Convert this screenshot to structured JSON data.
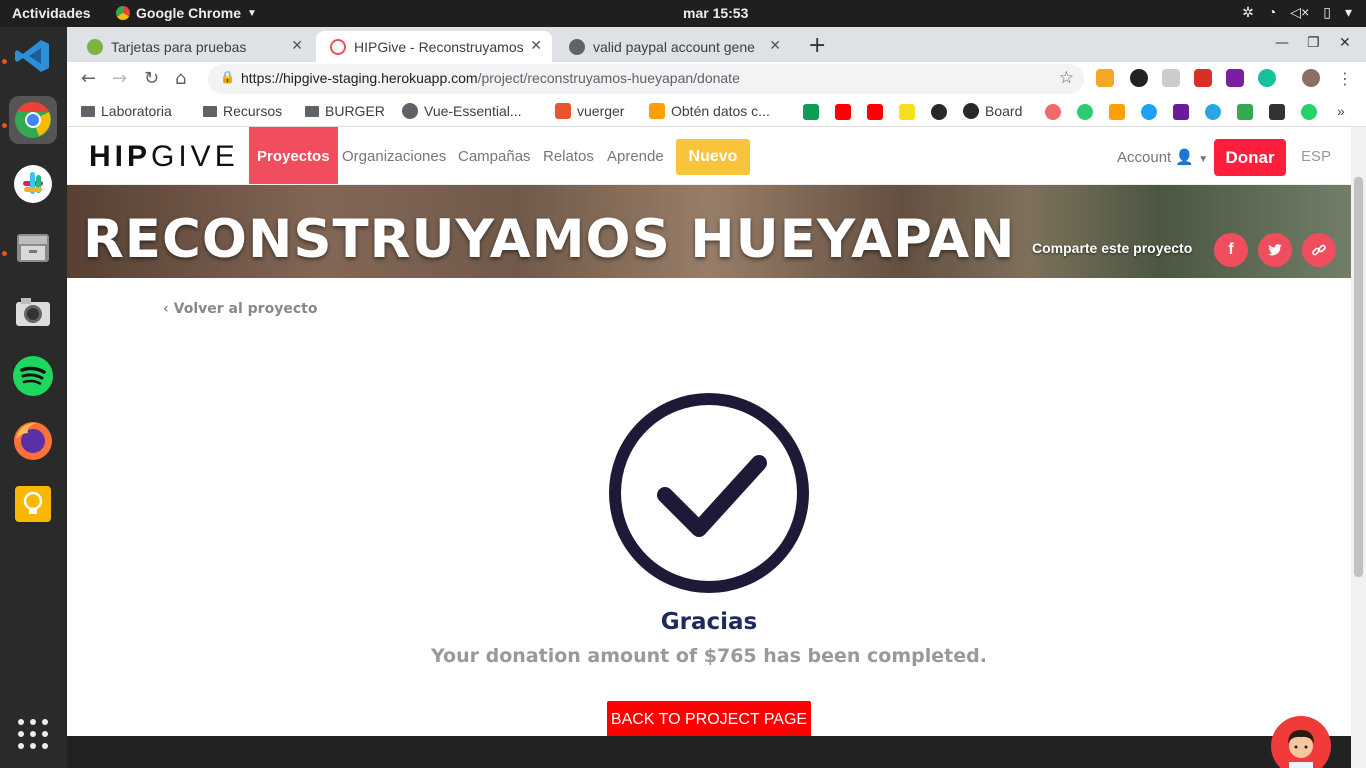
{
  "topbar": {
    "activities": "Actividades",
    "app_name": "Google Chrome",
    "clock": "mar 15:53"
  },
  "tabs": [
    {
      "title": "Tarjetas para pruebas"
    },
    {
      "title": "HIPGive - Reconstruyamos"
    },
    {
      "title": "valid paypal account gene"
    }
  ],
  "url": {
    "host": "https://hipgive-staging.herokuapp.com",
    "path": "/project/reconstruyamos-hueyapan/donate"
  },
  "bookmarks": [
    {
      "label": "Laboratoria"
    },
    {
      "label": "Recursos"
    },
    {
      "label": "BURGER"
    },
    {
      "label": "Vue-Essential..."
    },
    {
      "label": "vuerger"
    },
    {
      "label": "Obtén datos c..."
    },
    {
      "label": "Board"
    }
  ],
  "site": {
    "logo_bold": "HIP",
    "logo_light": "GIVE",
    "nav": [
      "Proyectos",
      "Organizaciones",
      "Campañas",
      "Relatos",
      "Aprende"
    ],
    "nuevo": "Nuevo",
    "account": "Account",
    "donar": "Donar",
    "lang": "ESP"
  },
  "hero": {
    "title": "RECONSTRUYAMOS HUEYAPAN",
    "share_label": "Comparte este proyecto"
  },
  "content": {
    "back_link": "Volver al proyecto",
    "thanks": "Gracias",
    "message": "Your donation amount of $765 has been completed.",
    "back_button": "BACK TO PROJECT PAGE"
  },
  "colors": {
    "accent": "#f04e5e",
    "donar": "#ff1f3d",
    "nuevo": "#f9c33c",
    "check": "#1c1a37",
    "back_button": "#ff0000"
  }
}
